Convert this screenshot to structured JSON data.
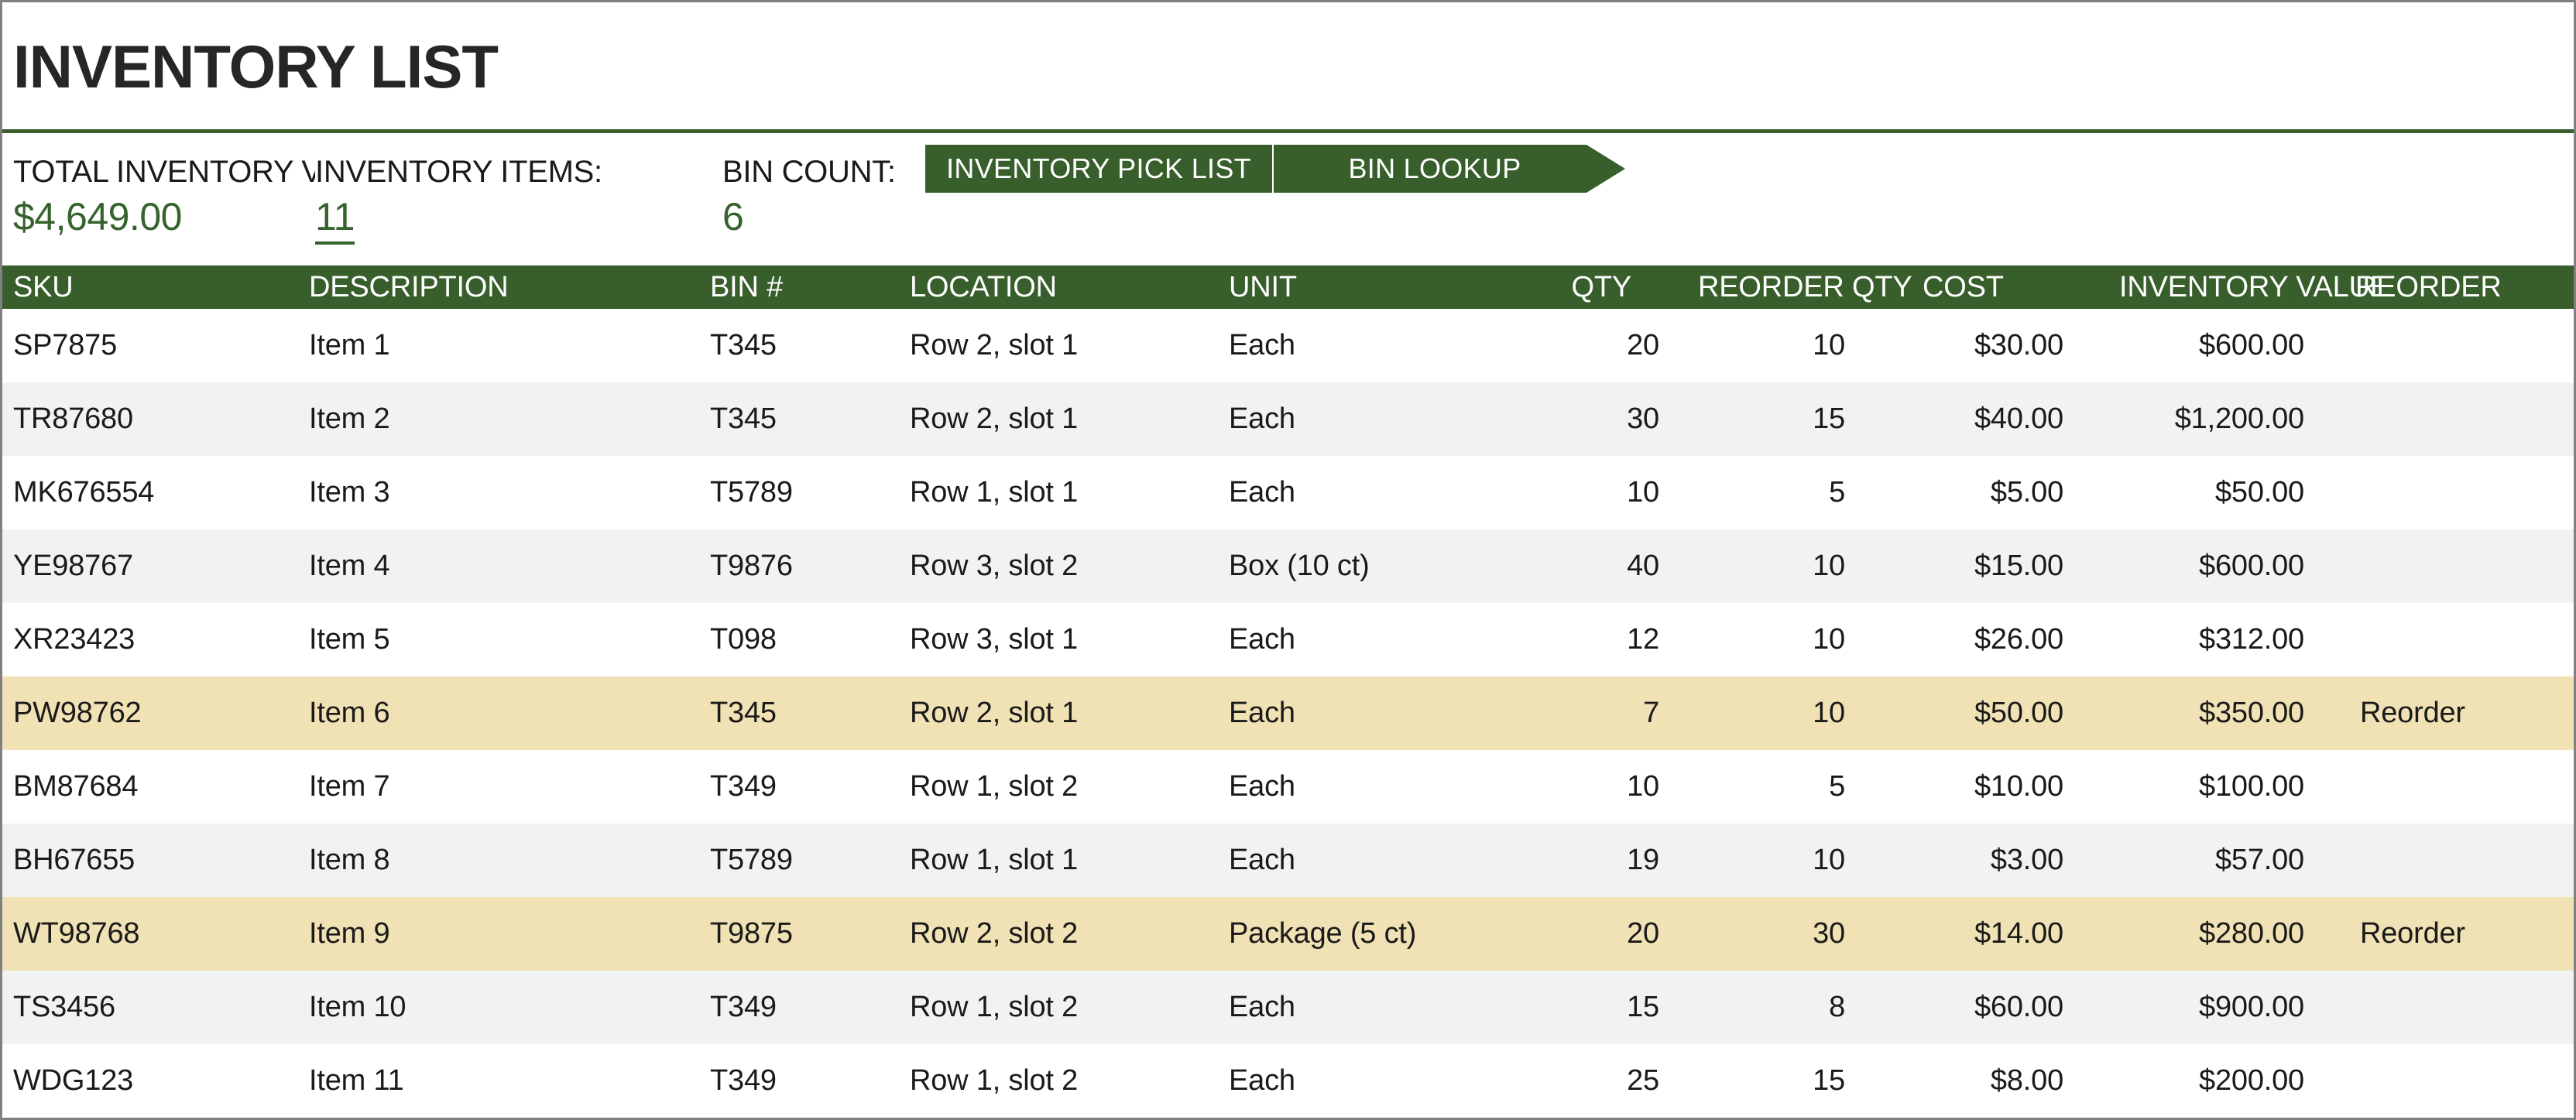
{
  "document": {
    "title": "INVENTORY LIST"
  },
  "summary": {
    "total_value": {
      "label": "TOTAL INVENTORY VAI",
      "value": "$4,649.00"
    },
    "item_count": {
      "label": "INVENTORY ITEMS:",
      "value": "11"
    },
    "bin_count": {
      "label": "BIN COUNT:",
      "value": "6"
    }
  },
  "nav": {
    "pick_list": "INVENTORY PICK LIST",
    "bin_lookup": "BIN LOOKUP"
  },
  "colors": {
    "header_green": "#375E2B",
    "value_green": "#36622E",
    "reorder_highlight": "#F0E2B4",
    "band_gray": "#f2f2f2"
  },
  "table": {
    "columns": [
      "SKU",
      "DESCRIPTION",
      "BIN #",
      "LOCATION",
      "UNIT",
      "QTY",
      "REORDER QTY",
      "COST",
      "INVENTORY VALUE",
      "REORDER"
    ],
    "rows": [
      {
        "sku": "SP7875",
        "description": "Item 1",
        "bin": "T345",
        "location": "Row 2, slot 1",
        "unit": "Each",
        "qty": "20",
        "reorder_qty": "10",
        "cost": "$30.00",
        "inventory_value": "$600.00",
        "reorder": "",
        "style": "plain"
      },
      {
        "sku": "TR87680",
        "description": "Item 2",
        "bin": "T345",
        "location": "Row 2, slot 1",
        "unit": "Each",
        "qty": "30",
        "reorder_qty": "15",
        "cost": "$40.00",
        "inventory_value": "$1,200.00",
        "reorder": "",
        "style": "band"
      },
      {
        "sku": "MK676554",
        "description": "Item 3",
        "bin": "T5789",
        "location": "Row 1, slot 1",
        "unit": "Each",
        "qty": "10",
        "reorder_qty": "5",
        "cost": "$5.00",
        "inventory_value": "$50.00",
        "reorder": "",
        "style": "plain"
      },
      {
        "sku": "YE98767",
        "description": "Item 4",
        "bin": "T9876",
        "location": "Row 3, slot 2",
        "unit": "Box (10 ct)",
        "qty": "40",
        "reorder_qty": "10",
        "cost": "$15.00",
        "inventory_value": "$600.00",
        "reorder": "",
        "style": "band"
      },
      {
        "sku": "XR23423",
        "description": "Item 5",
        "bin": "T098",
        "location": "Row 3, slot 1",
        "unit": "Each",
        "qty": "12",
        "reorder_qty": "10",
        "cost": "$26.00",
        "inventory_value": "$312.00",
        "reorder": "",
        "style": "plain"
      },
      {
        "sku": "PW98762",
        "description": "Item 6",
        "bin": "T345",
        "location": "Row 2, slot 1",
        "unit": "Each",
        "qty": "7",
        "reorder_qty": "10",
        "cost": "$50.00",
        "inventory_value": "$350.00",
        "reorder": "Reorder",
        "style": "reorder"
      },
      {
        "sku": "BM87684",
        "description": "Item 7",
        "bin": "T349",
        "location": "Row 1, slot 2",
        "unit": "Each",
        "qty": "10",
        "reorder_qty": "5",
        "cost": "$10.00",
        "inventory_value": "$100.00",
        "reorder": "",
        "style": "plain"
      },
      {
        "sku": "BH67655",
        "description": "Item 8",
        "bin": "T5789",
        "location": "Row 1, slot 1",
        "unit": "Each",
        "qty": "19",
        "reorder_qty": "10",
        "cost": "$3.00",
        "inventory_value": "$57.00",
        "reorder": "",
        "style": "band"
      },
      {
        "sku": "WT98768",
        "description": "Item 9",
        "bin": "T9875",
        "location": "Row 2, slot 2",
        "unit": "Package (5 ct)",
        "qty": "20",
        "reorder_qty": "30",
        "cost": "$14.00",
        "inventory_value": "$280.00",
        "reorder": "Reorder",
        "style": "reorder"
      },
      {
        "sku": "TS3456",
        "description": "Item 10",
        "bin": "T349",
        "location": "Row 1, slot 2",
        "unit": "Each",
        "qty": "15",
        "reorder_qty": "8",
        "cost": "$60.00",
        "inventory_value": "$900.00",
        "reorder": "",
        "style": "band"
      },
      {
        "sku": "WDG123",
        "description": "Item 11",
        "bin": "T349",
        "location": "Row 1, slot 2",
        "unit": "Each",
        "qty": "25",
        "reorder_qty": "15",
        "cost": "$8.00",
        "inventory_value": "$200.00",
        "reorder": "",
        "style": "plain"
      }
    ]
  }
}
